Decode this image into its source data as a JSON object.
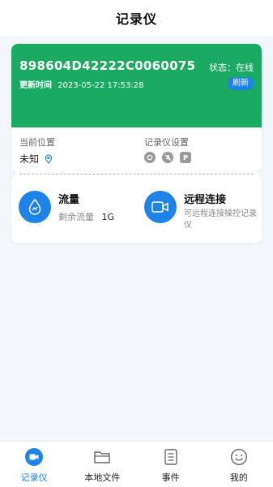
{
  "header": {
    "title": "记录仪"
  },
  "device": {
    "serial": "898604D42222C0060075",
    "status": "状态：在线",
    "update_label": "更新时间",
    "update_time": "2023-05-22 17:53:28",
    "refresh_label": "刷新"
  },
  "info": {
    "location_label": "当前位置",
    "location_value": "未知",
    "settings_label": "记录仪设置",
    "settings_icons": [
      "record-icon",
      "mic-off-icon",
      "parking-icon"
    ],
    "settings_icon_p": "P"
  },
  "flow": {
    "title": "流量",
    "remaining_label": "剩余流量",
    "remaining_value": "1G"
  },
  "remote": {
    "title": "远程连接",
    "desc": "可远程连接操控记录仪"
  },
  "tabs": [
    {
      "label": "记录仪",
      "icon": "dashcam-icon",
      "active": true
    },
    {
      "label": "本地文件",
      "icon": "folder-icon",
      "active": false
    },
    {
      "label": "事件",
      "icon": "document-icon",
      "active": false
    },
    {
      "label": "我的",
      "icon": "smiley-icon",
      "active": false
    }
  ],
  "colors": {
    "accent": "#1e82e8",
    "device_bg": "#1aaa62",
    "page_bg": "#f3f6fa"
  }
}
